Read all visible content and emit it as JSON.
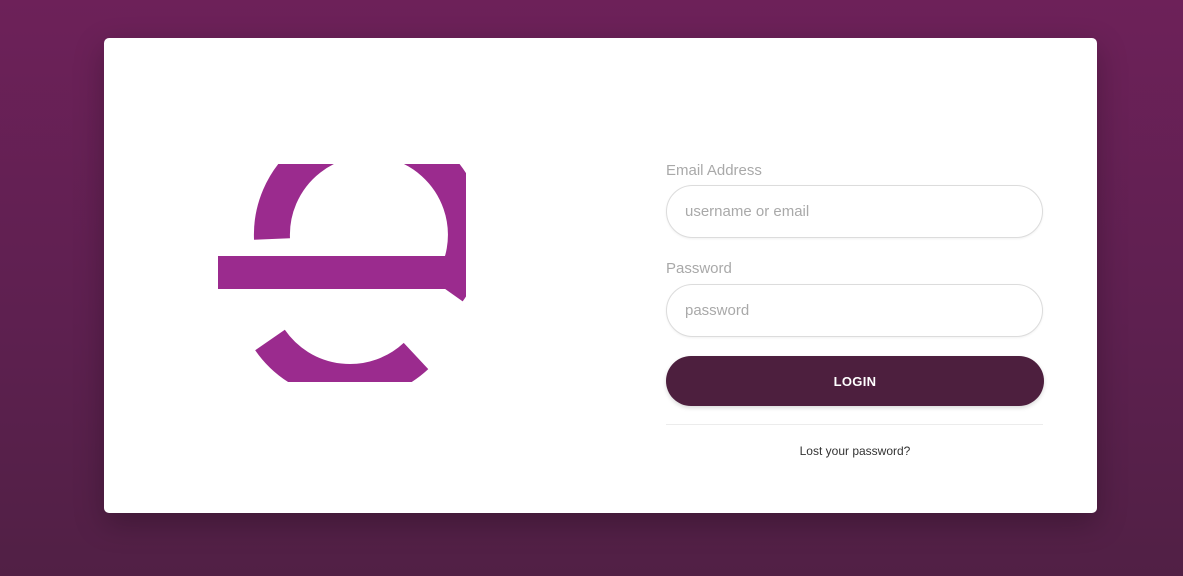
{
  "brand": {
    "logo_icon": "e-letter-logo-icon",
    "logo_color": "#9b2b8e"
  },
  "colors": {
    "background": "#6d2159",
    "button": "#4d1f3e",
    "label": "#a9a9a9"
  },
  "login_form": {
    "email_label": "Email Address",
    "email_placeholder": "username or email",
    "email_value": "",
    "password_label": "Password",
    "password_placeholder": "password",
    "password_value": "",
    "login_label": "LOGIN",
    "lost_password_label": "Lost your password?"
  }
}
